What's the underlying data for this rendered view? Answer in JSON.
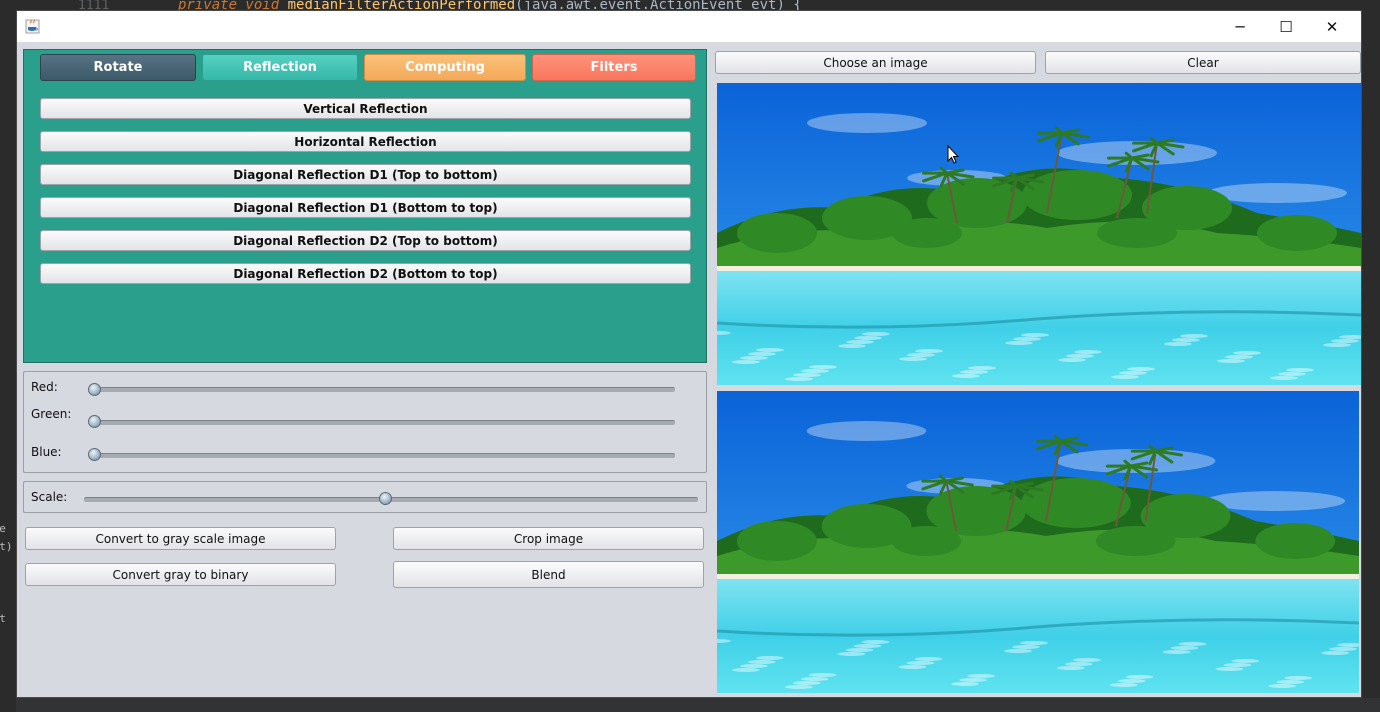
{
  "background_ide": {
    "line_number": "1111",
    "code_keywords": "private void",
    "code_method": "medianFilterActionPerformed",
    "code_params": "(java.awt.event.ActionEvent evt) {",
    "left_fragments": [
      "t e",
      "evt)",
      "",
      "t)",
      "",
      "ent",
      ")",
      "",
      ")",
      ")"
    ]
  },
  "window": {
    "controls": {
      "minimize": "─",
      "maximize": "☐",
      "close": "✕"
    }
  },
  "tabs": [
    {
      "label": "Rotate",
      "color": "#4a6878"
    },
    {
      "label": "Reflection",
      "color": "#45c6b7"
    },
    {
      "label": "Computing",
      "color": "#f7b46a"
    },
    {
      "label": "Filters",
      "color": "#fb836b"
    }
  ],
  "active_tab": "Reflection",
  "tab_panel_color": "#2a9f8c",
  "reflection_buttons": [
    "Vertical Reflection",
    "Horizontal Reflection",
    "Diagonal Reflection D1 (Top to bottom)",
    "Diagonal Reflection D1 (Bottom to top)",
    "Diagonal Reflection D2 (Top to bottom)",
    "Diagonal Reflection D2 (Bottom to top)"
  ],
  "sliders": {
    "red": {
      "label": "Red:",
      "value_fraction": 0.0
    },
    "green": {
      "label": "Green:",
      "value_fraction": 0.0
    },
    "blue": {
      "label": "Blue:",
      "value_fraction": 0.0
    },
    "scale": {
      "label": "Scale:",
      "value_fraction": 0.5
    }
  },
  "actions": {
    "gray_scale": "Convert to gray scale image",
    "crop": "Crop image",
    "gray_to_binary": "Convert gray to binary",
    "blend": "Blend"
  },
  "image_controls": {
    "choose": "Choose an image",
    "clear": "Clear"
  },
  "images": [
    {
      "description_icon": "tropical-island-image"
    },
    {
      "description_icon": "tropical-island-image"
    }
  ]
}
